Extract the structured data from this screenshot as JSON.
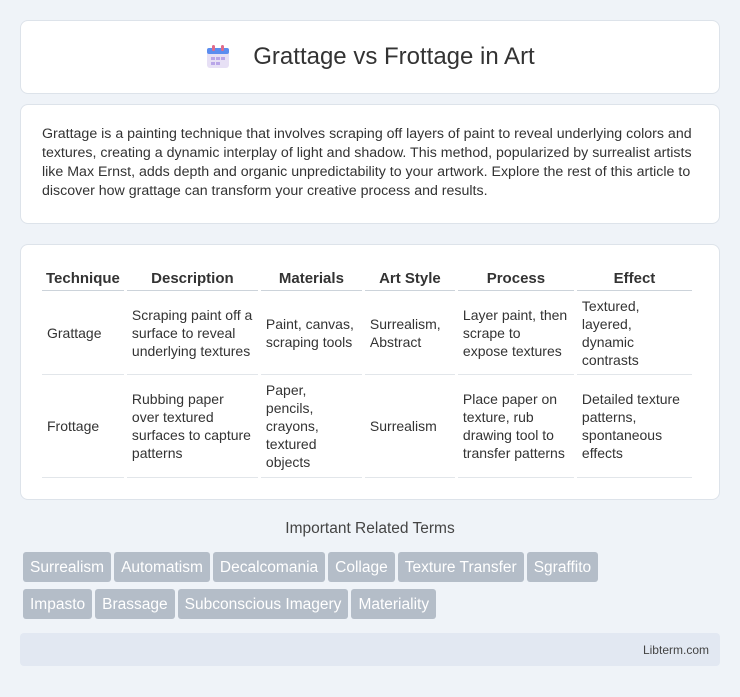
{
  "header": {
    "title": "Grattage vs Frottage in Art",
    "icon": "calendar-icon"
  },
  "intro": {
    "text": "Grattage is a painting technique that involves scraping off layers of paint to reveal underlying colors and textures, creating a dynamic interplay of light and shadow. This method, popularized by surrealist artists like Max Ernst, adds depth and organic unpredictability to your artwork. Explore the rest of this article to discover how grattage can transform your creative process and results."
  },
  "table": {
    "headers": [
      "Technique",
      "Description",
      "Materials",
      "Art Style",
      "Process",
      "Effect"
    ],
    "rows": [
      [
        "Grattage",
        "Scraping paint off a surface to reveal underlying textures",
        "Paint, canvas, scraping tools",
        "Surrealism, Abstract",
        "Layer paint, then scrape to expose textures",
        "Textured, layered, dynamic contrasts"
      ],
      [
        "Frottage",
        "Rubbing paper over textured surfaces to capture patterns",
        "Paper, pencils, crayons, textured objects",
        "Surrealism",
        "Place paper on texture, rub drawing tool to transfer patterns",
        "Detailed texture patterns, spontaneous effects"
      ]
    ]
  },
  "terms": {
    "title": "Important Related Terms",
    "items": [
      "Surrealism",
      "Automatism",
      "Decalcomania",
      "Collage",
      "Texture Transfer",
      "Sgraffito",
      "Impasto",
      "Brassage",
      "Subconscious Imagery",
      "Materiality"
    ]
  },
  "footer": {
    "site": "Libterm.com"
  }
}
